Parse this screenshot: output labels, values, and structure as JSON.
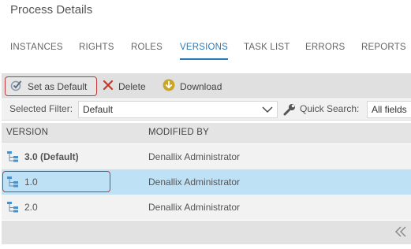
{
  "page": {
    "title": "Process Details"
  },
  "tabs": [
    {
      "label": "INSTANCES"
    },
    {
      "label": "RIGHTS"
    },
    {
      "label": "ROLES"
    },
    {
      "label": "VERSIONS"
    },
    {
      "label": "TASK LIST"
    },
    {
      "label": "ERRORS"
    },
    {
      "label": "REPORTS"
    }
  ],
  "active_tab": "VERSIONS",
  "toolbar": {
    "set_default_label": "Set as Default",
    "delete_label": "Delete",
    "download_label": "Download"
  },
  "filter": {
    "label": "Selected Filter:",
    "value": "Default",
    "quick_search_label": "Quick Search:",
    "quick_search_value": "All fields"
  },
  "table": {
    "columns": [
      "VERSION",
      "MODIFIED BY"
    ],
    "rows": [
      {
        "version": "3.0 (Default)",
        "modified_by": "Denallix Administrator"
      },
      {
        "version": "1.0",
        "modified_by": "Denallix Administrator"
      },
      {
        "version": "2.0",
        "modified_by": "Denallix Administrator"
      }
    ]
  },
  "colors": {
    "accent": "#2a7ab8",
    "highlight_outline": "#c0393b",
    "selected_row": "#bfe1f6"
  },
  "icons": [
    "checkmark-icon",
    "delete-x-icon",
    "download-icon",
    "wrench-icon",
    "process-tree-icon",
    "chevron-down-icon",
    "double-chevron-left-icon"
  ]
}
